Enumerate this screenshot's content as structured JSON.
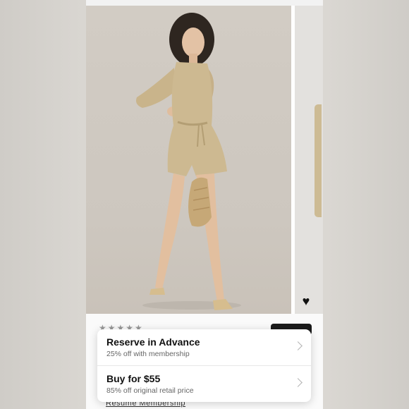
{
  "rating": {
    "stars": "★★★★★"
  },
  "options": [
    {
      "title": "Reserve in Advance",
      "subtitle": "25% off with membership"
    },
    {
      "title": "Buy for $55",
      "subtitle": "85% off original retail price"
    }
  ],
  "footer": {
    "resume_label": "Resume Membership"
  },
  "icons": {
    "favorite": "heart-icon",
    "chevron": "chevron-right-icon"
  },
  "colors": {
    "photo_bg": "#cdc7bf",
    "romper": "#cdb991",
    "sheet_bg": "#ffffff"
  }
}
